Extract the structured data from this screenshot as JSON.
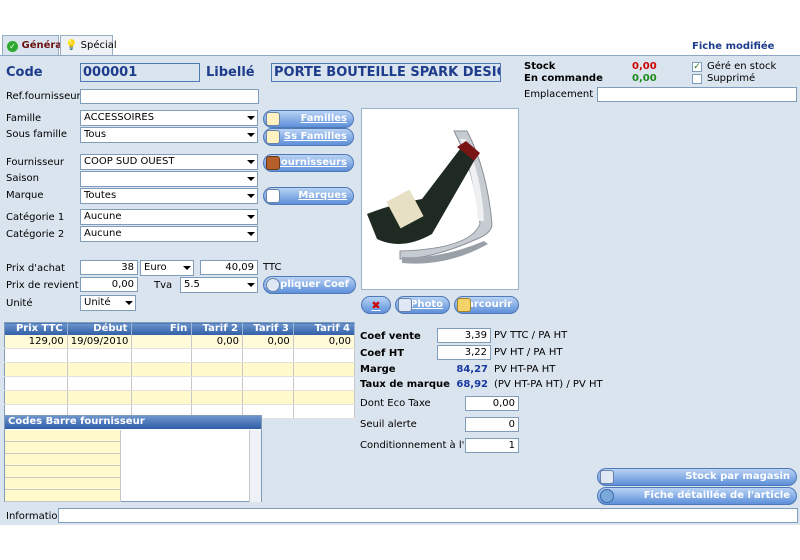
{
  "tabs": [
    {
      "label": "Général"
    },
    {
      "label": "Spécial"
    }
  ],
  "header": {
    "status": "Fiche modifiée"
  },
  "code": {
    "label": "Code",
    "value": "000001"
  },
  "libelle": {
    "label": "Libellé",
    "value": "PORTE BOUTEILLE SPARK DESIGN"
  },
  "stock": {
    "stock_label": "Stock",
    "stock_value": "0,00",
    "commande_label": "En commande",
    "commande_value": "0,00",
    "gere_label": "Géré en stock",
    "supprime_label": "Supprimé",
    "emplacement_label": "Emplacement"
  },
  "ref": {
    "label": "Ref.fournisseur",
    "value": ""
  },
  "famille": {
    "label": "Famille",
    "value": "ACCESSOIRES"
  },
  "sous_famille": {
    "label": "Sous famille",
    "value": "Tous"
  },
  "fournisseur": {
    "label": "Fournisseur",
    "value": "COOP SUD OUEST"
  },
  "saison": {
    "label": "Saison",
    "value": ""
  },
  "marque": {
    "label": "Marque",
    "value": "Toutes"
  },
  "categorie1": {
    "label": "Catégorie 1",
    "value": "Aucune"
  },
  "categorie2": {
    "label": "Catégorie 2",
    "value": "Aucune"
  },
  "buttons": {
    "familles": "Familles",
    "ss_familles": "Ss Familles",
    "fournisseurs": "Fournisseurs",
    "marques": "Marques",
    "appliquer_coef": "Appliquer Coef",
    "photo": "Photo",
    "parcourir": "Parcourir",
    "stock_magasin": "Stock par magasin",
    "fiche_detaillee": "Fiche détaillée de l'article"
  },
  "prix": {
    "achat_label": "Prix d'achat",
    "achat_value": "38",
    "devise": "Euro",
    "achat_ttc": "40,09",
    "ttc_label": "TTC",
    "revient_label": "Prix de revient",
    "revient_value": "0,00",
    "tva_label": "Tva",
    "tva_value": "5.5",
    "unite_label": "Unité",
    "unite_value": "Unité"
  },
  "price_grid": {
    "columns": [
      "Prix TTC",
      "Début",
      "Fin",
      "Tarif 2",
      "Tarif 3",
      "Tarif 4"
    ],
    "rows": [
      [
        "129,00",
        "19/09/2010",
        "",
        "0,00",
        "0,00",
        "0,00"
      ]
    ]
  },
  "codes_barre": {
    "title": "Codes Barre fournisseur"
  },
  "coefs": {
    "coef_vente_label": "Coef vente",
    "coef_vente_value": "3,39",
    "coef_vente_desc": "PV TTC / PA HT",
    "coef_ht_label": "Coef HT",
    "coef_ht_value": "3,22",
    "coef_ht_desc": "PV HT / PA HT",
    "marge_label": "Marge",
    "marge_value": "84,27",
    "marge_desc": "PV HT-PA HT",
    "taux_label": "Taux de marque",
    "taux_value": "68,92",
    "taux_desc": "(PV HT-PA HT) / PV HT",
    "eco_label": "Dont Eco Taxe",
    "eco_value": "0,00",
    "seuil_label": "Seuil alerte",
    "seuil_value": "0",
    "cond_label": "Conditionnement à l'achat",
    "cond_value": "1"
  },
  "information": {
    "label": "Information",
    "value": ""
  },
  "colors": {
    "accent": "#1e3c8c",
    "panel": "#dae4ee",
    "button": "#5d8fd9",
    "red": "#d00000",
    "green": "#1c8a1c"
  }
}
